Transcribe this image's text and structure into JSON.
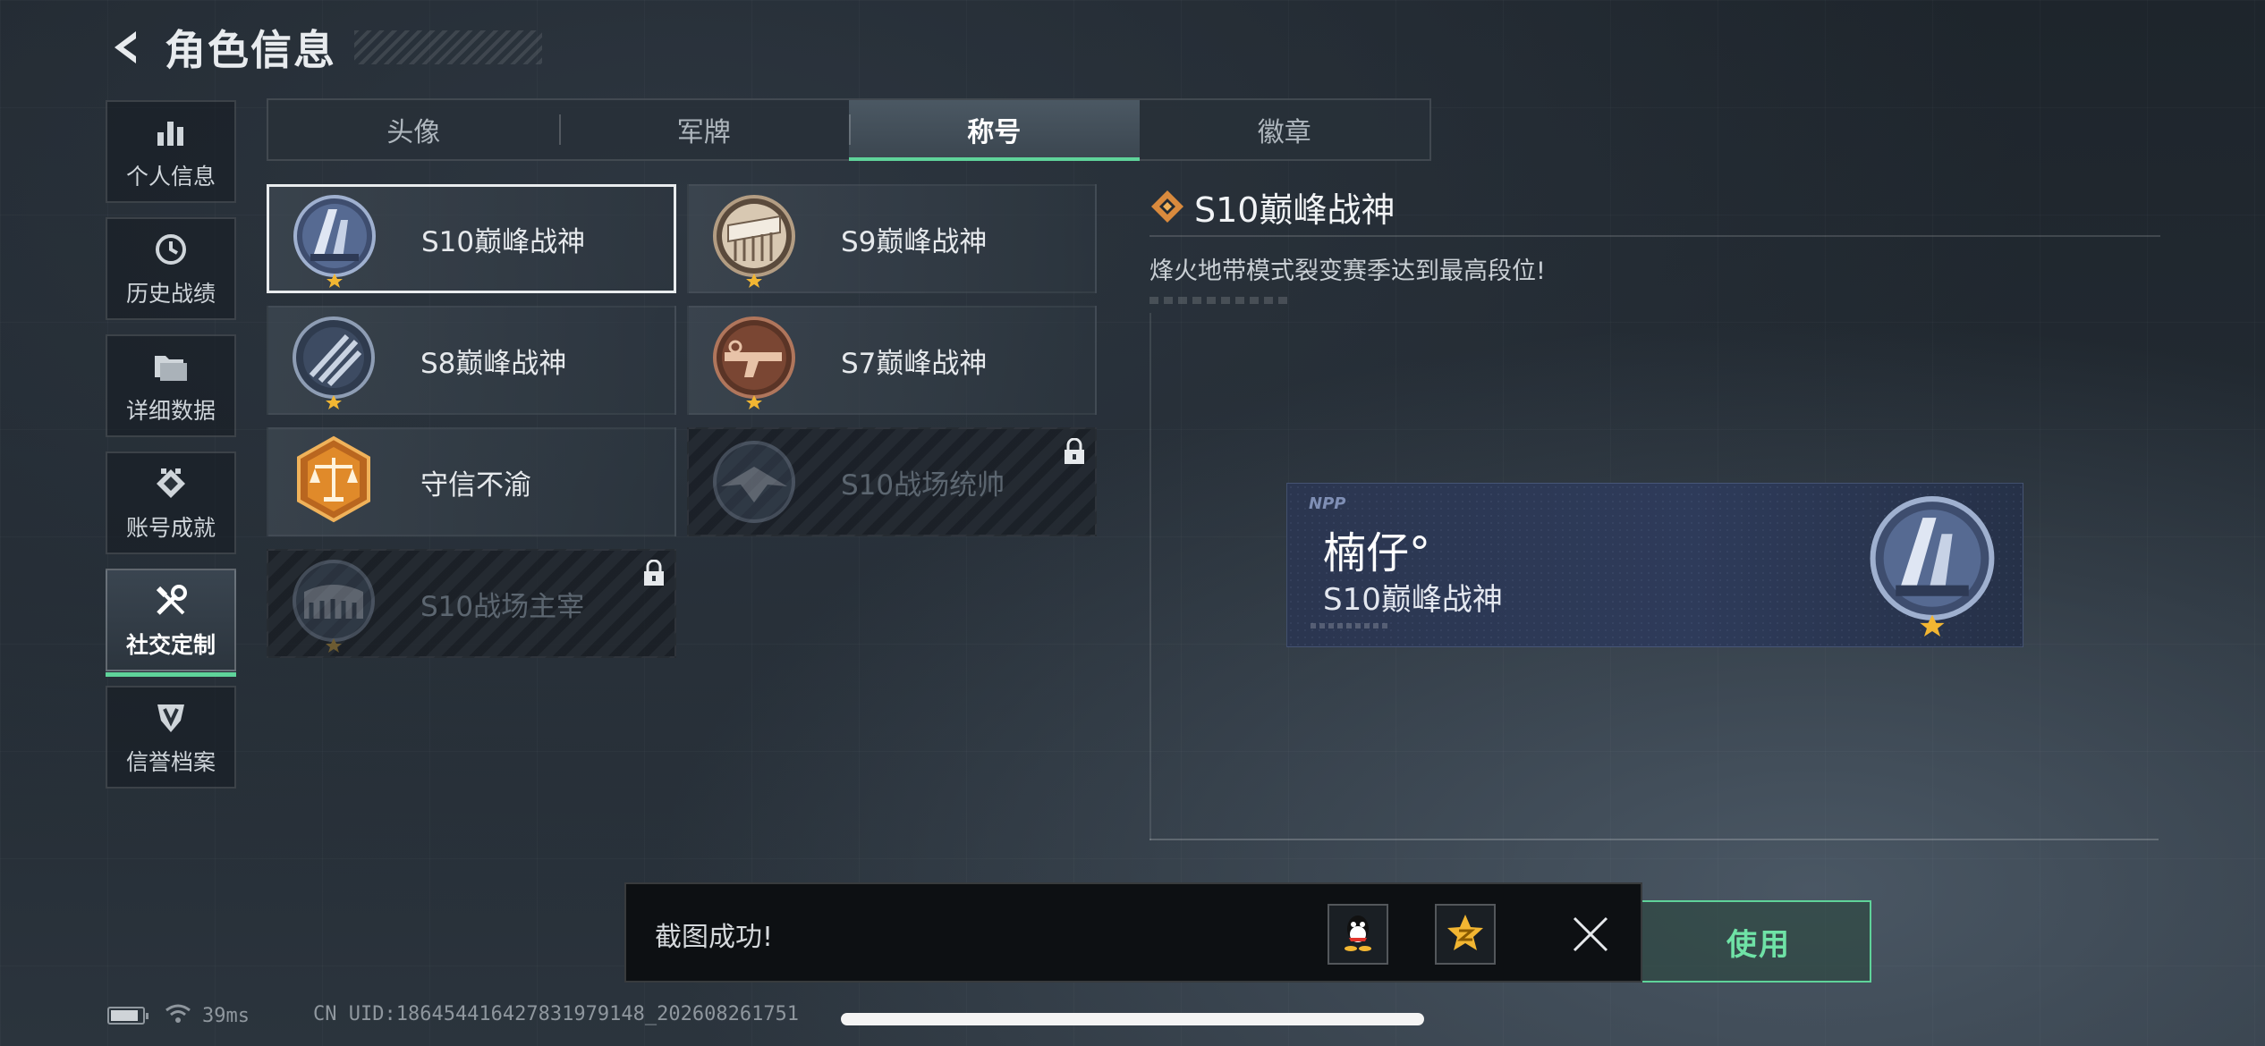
{
  "header": {
    "title": "角色信息"
  },
  "sidebar": {
    "items": [
      {
        "label": "个人信息",
        "icon": "bar-chart-icon",
        "active": false
      },
      {
        "label": "历史战绩",
        "icon": "history-clock-icon",
        "active": false
      },
      {
        "label": "详细数据",
        "icon": "folder-icon",
        "active": false
      },
      {
        "label": "账号成就",
        "icon": "achievement-icon",
        "active": false
      },
      {
        "label": "社交定制",
        "icon": "wrench-screwdriver-icon",
        "active": true
      },
      {
        "label": "信誉档案",
        "icon": "credit-shield-icon",
        "active": false
      }
    ]
  },
  "tabs": [
    {
      "label": "头像",
      "active": false
    },
    {
      "label": "军牌",
      "active": false
    },
    {
      "label": "称号",
      "active": true
    },
    {
      "label": "徽章",
      "active": false
    }
  ],
  "titles": [
    {
      "name": "S10巅峰战神",
      "selected": true,
      "locked": false,
      "emblem": "s10-peak-emblem"
    },
    {
      "name": "S9巅峰战神",
      "selected": false,
      "locked": false,
      "emblem": "s9-peak-emblem"
    },
    {
      "name": "S8巅峰战神",
      "selected": false,
      "locked": false,
      "emblem": "s8-peak-emblem"
    },
    {
      "name": "S7巅峰战神",
      "selected": false,
      "locked": false,
      "emblem": "s7-peak-emblem"
    },
    {
      "name": "守信不渝",
      "selected": false,
      "locked": false,
      "emblem": "scales-emblem"
    },
    {
      "name": "S10战场统帅",
      "selected": false,
      "locked": true,
      "emblem": "aircraft-emblem"
    },
    {
      "name": "S10战场主宰",
      "selected": false,
      "locked": true,
      "emblem": "colosseum-emblem"
    }
  ],
  "detail": {
    "title": "S10巅峰战神",
    "description": "烽火地带模式裂变赛季达到最高段位!"
  },
  "preview": {
    "logo": "NPP",
    "player_name": "楠仔°",
    "title": "S10巅峰战神"
  },
  "use_button": {
    "label": "使用"
  },
  "toast": {
    "message": "截图成功!",
    "share_targets": [
      "qq-icon",
      "qzone-icon"
    ],
    "close_icon": "close-icon"
  },
  "status": {
    "ping": "39ms",
    "uid": "CN UID:1864544164278319791​48_202608261751"
  },
  "colors": {
    "accent": "#5fd39a",
    "selected_border": "#e9ecee",
    "gold": "#f2b632"
  }
}
